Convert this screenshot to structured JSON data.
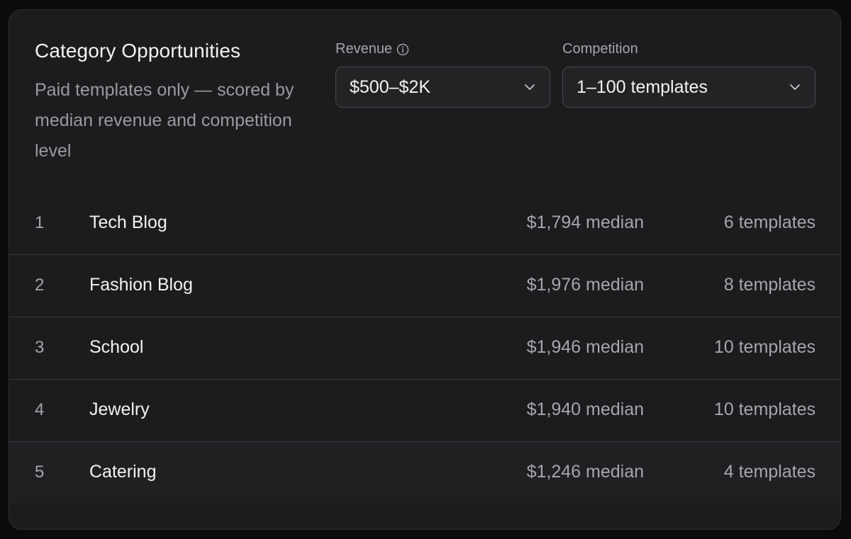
{
  "header": {
    "title": "Category Opportunities",
    "subtitle": "Paid templates only — scored by median revenue and competition level"
  },
  "filters": {
    "revenue": {
      "label": "Revenue",
      "info_icon": "info-circle-icon",
      "selected": "$500–$2K"
    },
    "competition": {
      "label": "Competition",
      "selected": "1–100 templates"
    }
  },
  "categories": [
    {
      "rank": "1",
      "name": "Tech Blog",
      "median": "$1,794 median",
      "templates": "6 templates"
    },
    {
      "rank": "2",
      "name": "Fashion Blog",
      "median": "$1,976 median",
      "templates": "8 templates"
    },
    {
      "rank": "3",
      "name": "School",
      "median": "$1,946 median",
      "templates": "10 templates"
    },
    {
      "rank": "4",
      "name": "Jewelry",
      "median": "$1,940 median",
      "templates": "10 templates"
    },
    {
      "rank": "5",
      "name": "Catering",
      "median": "$1,246 median",
      "templates": "4 templates"
    }
  ],
  "colors": {
    "background": "#0b0b0c",
    "card": "#1c1c1e",
    "text_primary": "#f2f2f3",
    "text_secondary": "#a6a6ab",
    "border": "#4a4a4f"
  }
}
